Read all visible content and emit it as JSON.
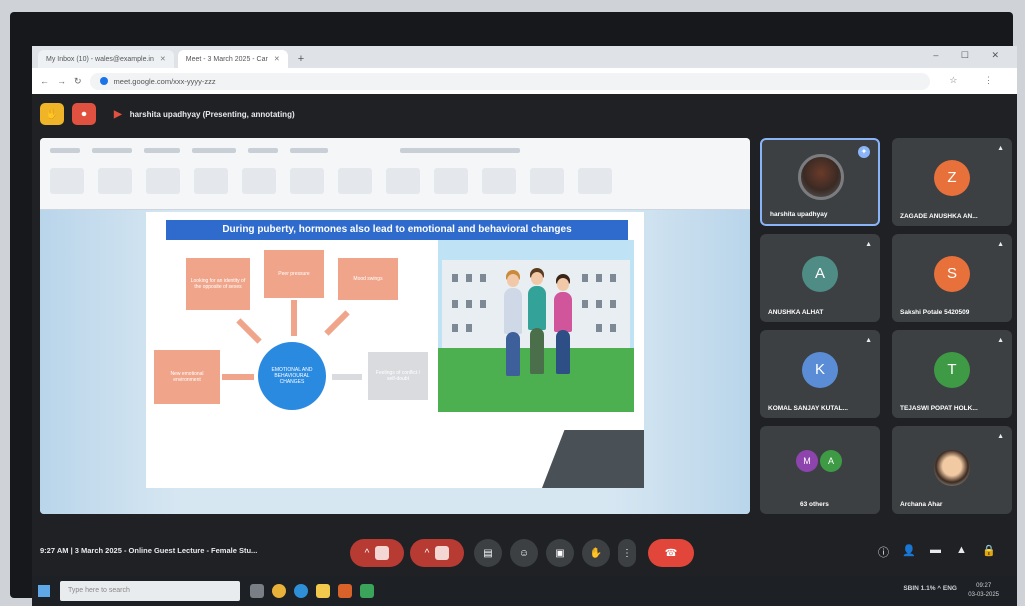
{
  "browser": {
    "tabs": [
      {
        "label": "My Inbox (10) - wales@example.in",
        "active": false
      },
      {
        "label": "Meet - 3 March 2025 - Car",
        "active": true
      }
    ],
    "new_tab": "+",
    "window_controls": "– ☐ ✕",
    "url": "meet.google.com/xxx-yyyy-zzz",
    "address_icons": "☆ ⋮"
  },
  "meet": {
    "presenter_banner": "harshita upadhyay (Presenting, annotating)",
    "meeting_info": "9:27 AM  |  3 March 2025 - Online Guest Lecture - Female Stu...",
    "participants": [
      {
        "name": "harshita upadhyay",
        "initial": "",
        "color": "#5b4a42",
        "type": "photo"
      },
      {
        "name": "ZAGADE ANUSHKA AN...",
        "initial": "Z",
        "color": "#e8703a"
      },
      {
        "name": "ANUSHKA ALHAT",
        "initial": "A",
        "color": "#4f8c86"
      },
      {
        "name": "Sakshi Potale 5420509",
        "initial": "S",
        "color": "#e8703a"
      },
      {
        "name": "KOMAL SANJAY KUTAL...",
        "initial": "K",
        "color": "#5b8dd6"
      },
      {
        "name": "TEJASWI POPAT HOLK...",
        "initial": "T",
        "color": "#3f9a45"
      },
      {
        "name": "63 others",
        "initials": [
          "M",
          "A"
        ],
        "colors": [
          "#8e44ad",
          "#3f9a45"
        ]
      },
      {
        "name": "Archana Ahar",
        "initial": "",
        "type": "photo2"
      }
    ]
  },
  "slide": {
    "title": "During puberty, hormones also lead to emotional and behavioral changes",
    "boxes": {
      "left_top": "Looking for an identity of the opposite of sexes",
      "top": "Peer pressure",
      "right_top": "Mood swings",
      "left": "New emotional environment",
      "center": "EMOTIONAL AND BEHAVIOURAL CHANGES",
      "right": "Feelings of conflict / self-doubt"
    }
  },
  "taskbar": {
    "search_placeholder": "Type here to search",
    "tray": "SBIN  1.1%  ^  ENG",
    "time": "09:27",
    "date": "03-03-2025"
  }
}
